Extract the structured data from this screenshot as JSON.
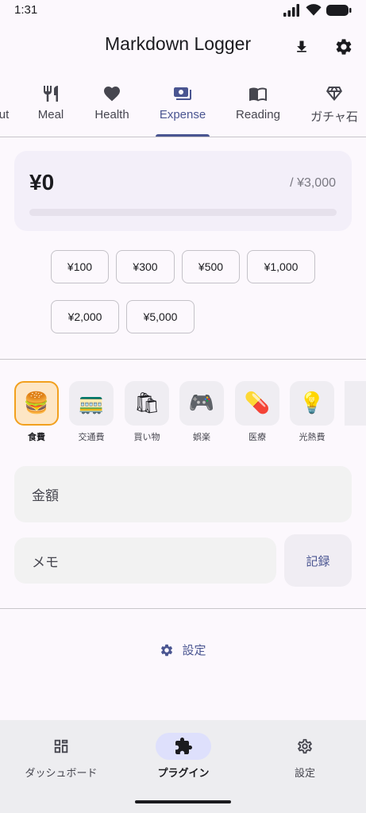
{
  "status_bar": {
    "time": "1:31"
  },
  "app_bar": {
    "title": "Markdown Logger",
    "actions": [
      {
        "icon": "download-icon"
      },
      {
        "icon": "gear-icon"
      }
    ]
  },
  "tabs": [
    {
      "label": "ut",
      "icon": "partial-tab-icon"
    },
    {
      "label": "Meal",
      "icon": "fork-knife-icon"
    },
    {
      "label": "Health",
      "icon": "heart-icon"
    },
    {
      "label": "Expense",
      "icon": "payments-icon",
      "active": true
    },
    {
      "label": "Reading",
      "icon": "book-icon"
    },
    {
      "label": "ガチャ石",
      "icon": "diamond-icon"
    }
  ],
  "budget": {
    "spent": "¥0",
    "limit": "/ ¥3,000",
    "progress": 0
  },
  "quick_amounts": [
    "¥100",
    "¥300",
    "¥500",
    "¥1,000",
    "¥2,000",
    "¥5,000"
  ],
  "categories": [
    {
      "label": "食費",
      "emoji": "🍔",
      "icon": "hamburger-icon",
      "selected": true
    },
    {
      "label": "交通費",
      "emoji": "🚃",
      "icon": "train-icon"
    },
    {
      "label": "買い物",
      "emoji": "🛍",
      "icon": "shopping-bags-icon"
    },
    {
      "label": "娯楽",
      "emoji": "🎮",
      "icon": "game-controller-icon"
    },
    {
      "label": "医療",
      "emoji": "💊",
      "icon": "pill-icon"
    },
    {
      "label": "光熱費",
      "emoji": "💡",
      "icon": "light-bulb-icon"
    }
  ],
  "form": {
    "amount_placeholder": "金額",
    "memo_placeholder": "メモ",
    "record_label": "記録"
  },
  "settings_link": {
    "label": "設定",
    "icon": "gear-icon"
  },
  "bottom_nav": [
    {
      "label": "ダッシュボード",
      "icon": "dashboard-icon"
    },
    {
      "label": "プラグイン",
      "icon": "puzzle-icon",
      "active": true
    },
    {
      "label": "設定",
      "icon": "gear-outline-icon"
    }
  ],
  "colors": {
    "accent": "#4a5591",
    "selected_category": "#f2a01e",
    "background": "#fcf8fd"
  }
}
